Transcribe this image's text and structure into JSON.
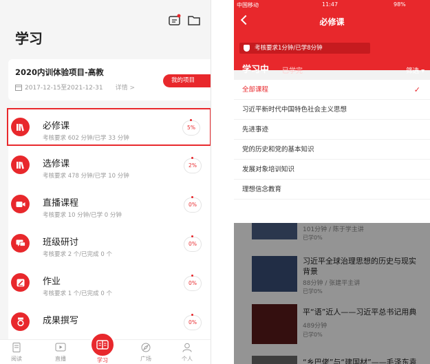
{
  "left": {
    "title": "学习",
    "project": {
      "name": "2020内训体验项目-高教",
      "dates": "2017-12-15至2021-12-31",
      "detail": "详情 >",
      "my_projects": "我的项目"
    },
    "courses": [
      {
        "name": "必修课",
        "sub": "考核要求 602 分钟/已学 33 分钟",
        "pct": "5%"
      },
      {
        "name": "选修课",
        "sub": "考核要求 478 分钟/已学 10 分钟",
        "pct": "2%"
      },
      {
        "name": "直播课程",
        "sub": "考核要求 10 分钟/已学 0 分钟",
        "pct": "0%"
      },
      {
        "name": "班级研讨",
        "sub": "考核要求 2 个/已完成 0 个",
        "pct": "0%"
      },
      {
        "name": "作业",
        "sub": "考核要求 1 个/已完成 0 个",
        "pct": "0%"
      },
      {
        "name": "成果撰写",
        "sub": "",
        "pct": "0%"
      }
    ],
    "tabs": [
      "阅读",
      "直播",
      "学习",
      "广场",
      "个人"
    ]
  },
  "right": {
    "status": {
      "carrier": "中国移动",
      "time": "11:47",
      "battery": "98%"
    },
    "nav_title": "必修课",
    "requirement": "考核要求1分钟/已学8分钟",
    "seg_active": "学习中",
    "seg_inactive": "已学完",
    "filter": "筛选 ▾",
    "filter_options": [
      {
        "label": "全部课程",
        "active": true
      },
      {
        "label": "习近平新时代中国特色社会主义思想",
        "active": false
      },
      {
        "label": "先进事迹",
        "active": false
      },
      {
        "label": "党的历史和党的基本知识",
        "active": false
      },
      {
        "label": "发展对象培训知识",
        "active": false
      },
      {
        "label": "理想信念教育",
        "active": false
      }
    ],
    "check": "✓",
    "list": [
      {
        "title": "",
        "meta": "101分钟 / 陈于学主讲",
        "prog": "已学0%"
      },
      {
        "title": "习近平全球治理思想的历史与现实背景",
        "meta": "88分钟 / 张建平主讲",
        "prog": "已学0%"
      },
      {
        "title": "平“语”近人——习近平总书记用典",
        "meta": "489分钟",
        "prog": "已学0%"
      },
      {
        "title": "“乡巴佬”与“建国材”——毛泽东袁",
        "meta": "",
        "prog": ""
      }
    ]
  }
}
